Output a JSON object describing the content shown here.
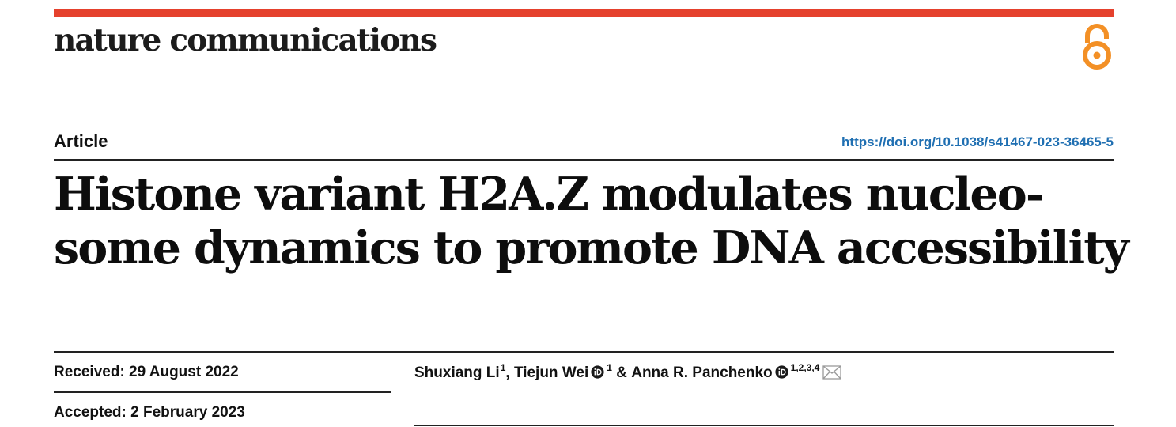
{
  "journal": {
    "name": "nature communications",
    "bar_color": "#e5412d",
    "open_access_icon": "open-access-icon",
    "open_access_color": "#f39026"
  },
  "article": {
    "type": "Article",
    "doi": "https://doi.org/10.1038/s41467-023-36465-5",
    "doi_color": "#1f6fb2",
    "title_lines": [
      "Histone variant H2A.Z modulates nucleo-",
      "some dynamics to promote DNA accessibility"
    ]
  },
  "dates": {
    "received": "Received: 29 August 2022",
    "accepted": "Accepted: 2 February 2023"
  },
  "authors": [
    {
      "name": "Shuxiang Li",
      "affil": "1",
      "orcid": false,
      "sep": ", "
    },
    {
      "name": "Tiejun Wei",
      "affil": "1",
      "orcid": true,
      "sep": " & "
    },
    {
      "name": "Anna R. Panchenko",
      "affil": "1,2,3,4",
      "orcid": true,
      "sep": "",
      "corresponding": true
    }
  ],
  "icons": {
    "orcid": "orcid-icon",
    "mail": "mail-icon"
  }
}
